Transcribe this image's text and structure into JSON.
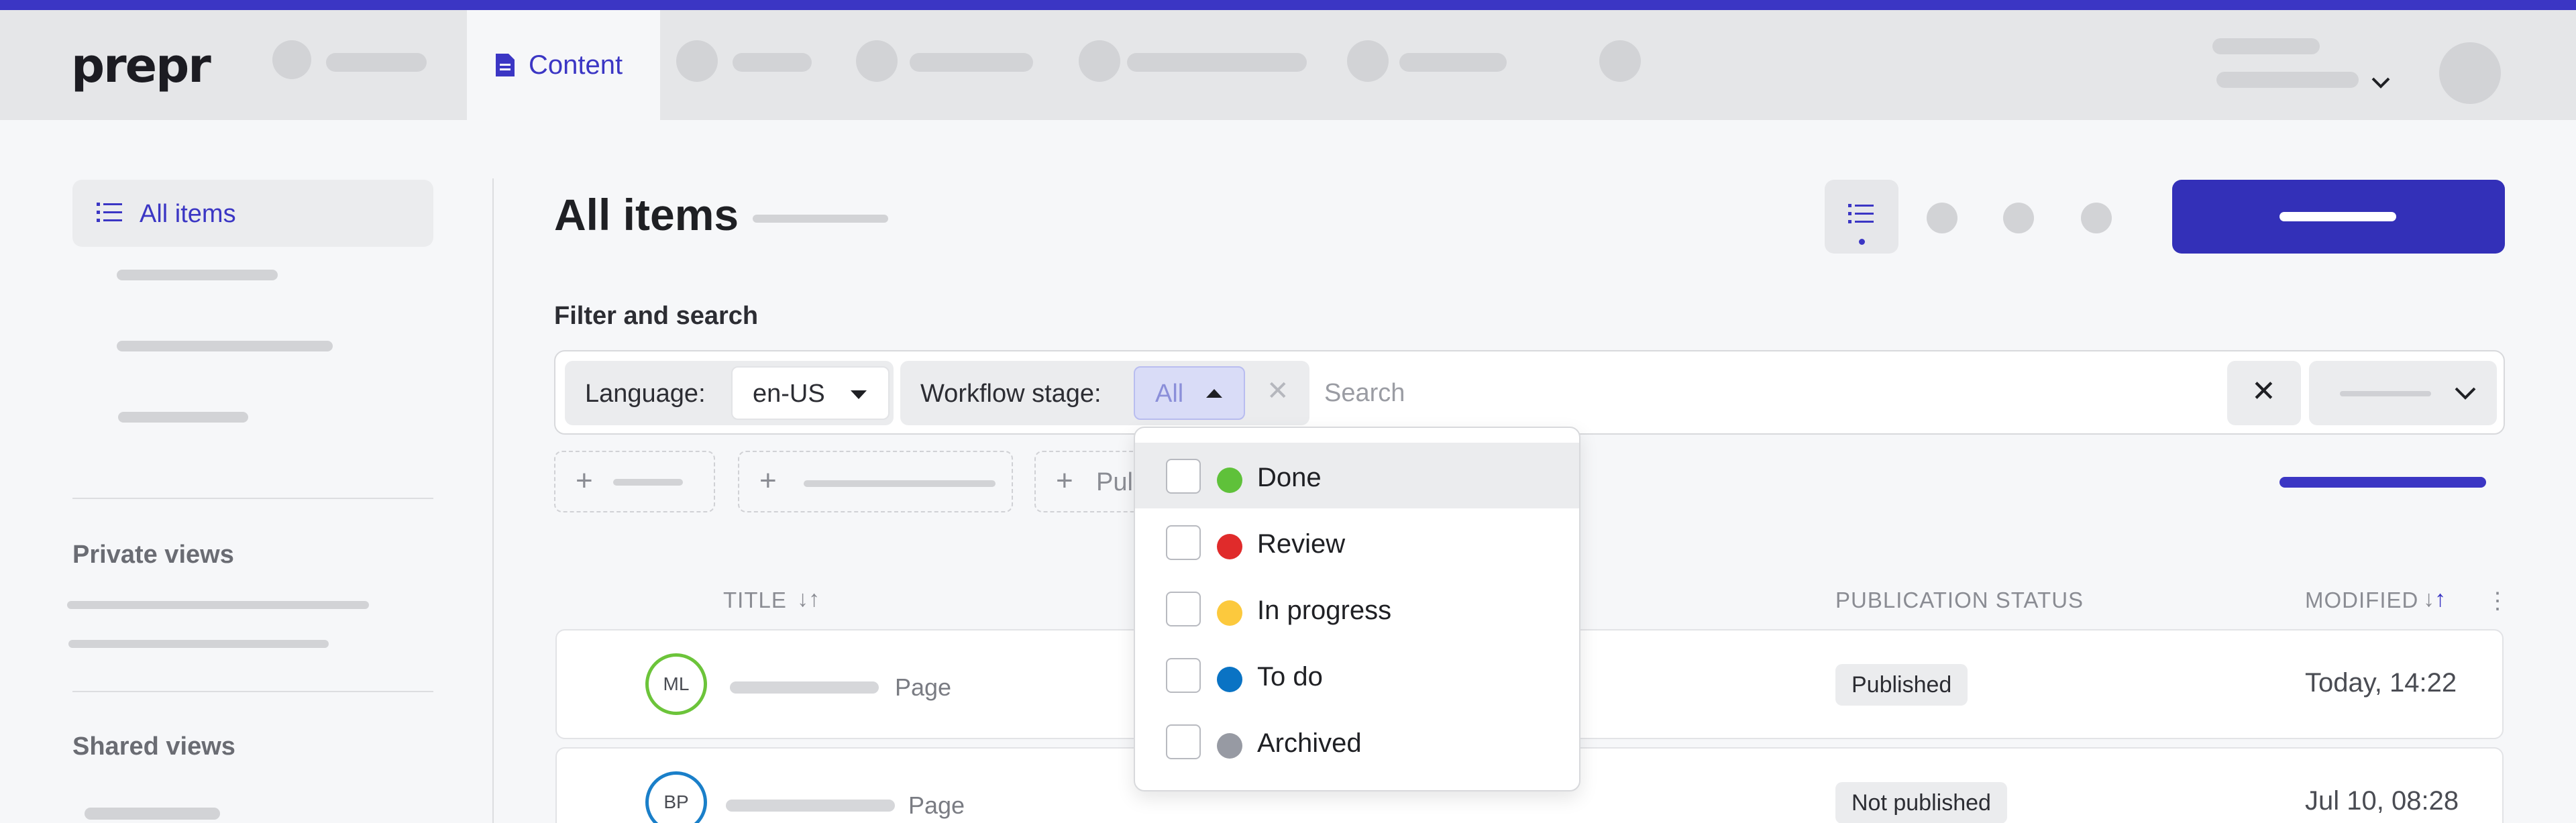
{
  "app": {
    "logo": "prepr",
    "accent_color": "#3b36c4"
  },
  "topnav": {
    "active_tab": {
      "label": "Content",
      "icon": "document-icon"
    }
  },
  "sidebar": {
    "active_item": {
      "label": "All items",
      "icon": "list-icon"
    },
    "private_views_heading": "Private views",
    "shared_views_heading": "Shared views"
  },
  "main": {
    "title": "All items",
    "filter_section_label": "Filter and search"
  },
  "filters": {
    "language_label": "Language:",
    "language_value": "en-US",
    "workflow_label": "Workflow stage:",
    "workflow_value": "All",
    "search_placeholder": "Search",
    "add_filter_partial": "Pul"
  },
  "workflow_options": [
    {
      "label": "Done",
      "color": "#5fc13a"
    },
    {
      "label": "Review",
      "color": "#e02b2b"
    },
    {
      "label": "In progress",
      "color": "#fcc93d"
    },
    {
      "label": "To do",
      "color": "#0a73c4"
    },
    {
      "label": "Archived",
      "color": "#979aa3"
    }
  ],
  "table": {
    "columns": {
      "title": "TITLE",
      "publication_status": "PUBLICATION STATUS",
      "modified": "MODIFIED"
    },
    "rows": [
      {
        "initials": "ML",
        "avatar_color": "#6cc43a",
        "type": "Page",
        "status": "Published",
        "modified": "Today, 14:22"
      },
      {
        "initials": "BP",
        "avatar_color": "#1a7fc9",
        "type": "Page",
        "status": "Not published",
        "modified": "Jul 10, 08:28"
      }
    ]
  }
}
